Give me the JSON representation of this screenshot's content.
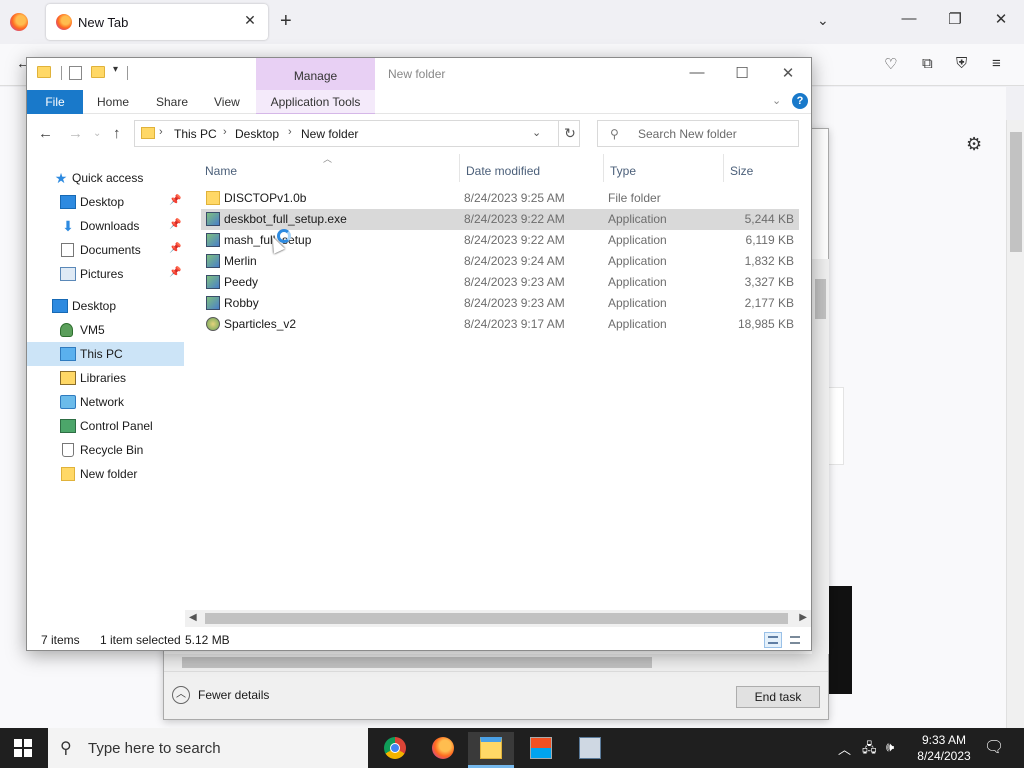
{
  "browser": {
    "tab_title": "New Tab",
    "tab_close": "✕",
    "new_tab": "+"
  },
  "explorer": {
    "window_title": "New folder",
    "manage_tab": "Manage",
    "ribbon": {
      "file": "File",
      "home": "Home",
      "share": "Share",
      "view": "View",
      "app_tools": "Application Tools"
    },
    "breadcrumbs": [
      "This PC",
      "Desktop",
      "New folder"
    ],
    "search_placeholder": "Search New folder",
    "nav": {
      "quick_access": "Quick access",
      "qa_items": [
        "Desktop",
        "Downloads",
        "Documents",
        "Pictures"
      ],
      "desktop": "Desktop",
      "vm5": "VM5",
      "this_pc": "This PC",
      "libraries": "Libraries",
      "network": "Network",
      "control_panel": "Control Panel",
      "recycle_bin": "Recycle Bin",
      "new_folder": "New folder"
    },
    "columns": {
      "name": "Name",
      "date": "Date modified",
      "type": "Type",
      "size": "Size"
    },
    "files": [
      {
        "name": "DISCTOPv1.0b",
        "date": "8/24/2023 9:25 AM",
        "type": "File folder",
        "size": ""
      },
      {
        "name": "deskbot_full_setup.exe",
        "date": "8/24/2023 9:22 AM",
        "type": "Application",
        "size": "5,244 KB"
      },
      {
        "name": "mash_full_setup",
        "date": "8/24/2023 9:22 AM",
        "type": "Application",
        "size": "6,119 KB"
      },
      {
        "name": "Merlin",
        "date": "8/24/2023 9:24 AM",
        "type": "Application",
        "size": "1,832 KB"
      },
      {
        "name": "Peedy",
        "date": "8/24/2023 9:23 AM",
        "type": "Application",
        "size": "3,327 KB"
      },
      {
        "name": "Robby",
        "date": "8/24/2023 9:23 AM",
        "type": "Application",
        "size": "2,177 KB"
      },
      {
        "name": "Sparticles_v2",
        "date": "8/24/2023 9:17 AM",
        "type": "Application",
        "size": "18,985 KB"
      }
    ],
    "status": {
      "items": "7 items",
      "selected": "1 item selected",
      "size": "5.12 MB"
    }
  },
  "task_manager": {
    "fewer_details": "Fewer details",
    "end_task": "End task"
  },
  "taskbar": {
    "search_placeholder": "Type here to search",
    "time": "9:33 AM",
    "date": "8/24/2023"
  }
}
